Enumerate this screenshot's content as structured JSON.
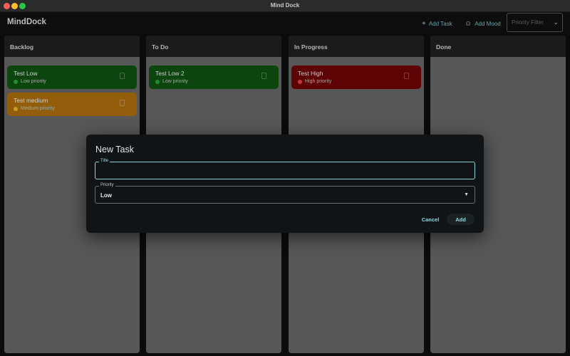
{
  "window": {
    "title": "Mind Dock"
  },
  "header": {
    "brand": "MindDock",
    "add_task": {
      "icon": "plus-icon",
      "label": "Add Task"
    },
    "add_mood": {
      "icon": "smiley-icon",
      "label": "Add Mood"
    },
    "priority_filter": {
      "placeholder": "Priority Filter",
      "value": ""
    }
  },
  "columns": [
    {
      "title": "Backlog",
      "cards": [
        {
          "title": "Test Low",
          "priority": "Low priority",
          "color": "#0f4f12",
          "dot": "#2aa13a"
        },
        {
          "title": "Test medium",
          "priority": "Medium priority",
          "color": "#a76b0e",
          "dot": "#e3b12a"
        }
      ]
    },
    {
      "title": "To Do",
      "cards": [
        {
          "title": "Test Low 2",
          "priority": "Low priority",
          "color": "#0f4f12",
          "dot": "#2aa13a"
        }
      ]
    },
    {
      "title": "In Progress",
      "cards": [
        {
          "title": "Test High",
          "priority": "High priority",
          "color": "#6b0404",
          "dot": "#e04040"
        }
      ]
    },
    {
      "title": "Done",
      "cards": []
    }
  ],
  "dialog": {
    "title": "New Task",
    "title_field": {
      "label": "Title",
      "value": ""
    },
    "priority_field": {
      "label": "Priority",
      "value": "Low"
    },
    "cancel_label": "Cancel",
    "add_label": "Add"
  },
  "colors": {
    "accent": "#92d6df",
    "surface": "#101417",
    "column_bg": "#646464"
  }
}
